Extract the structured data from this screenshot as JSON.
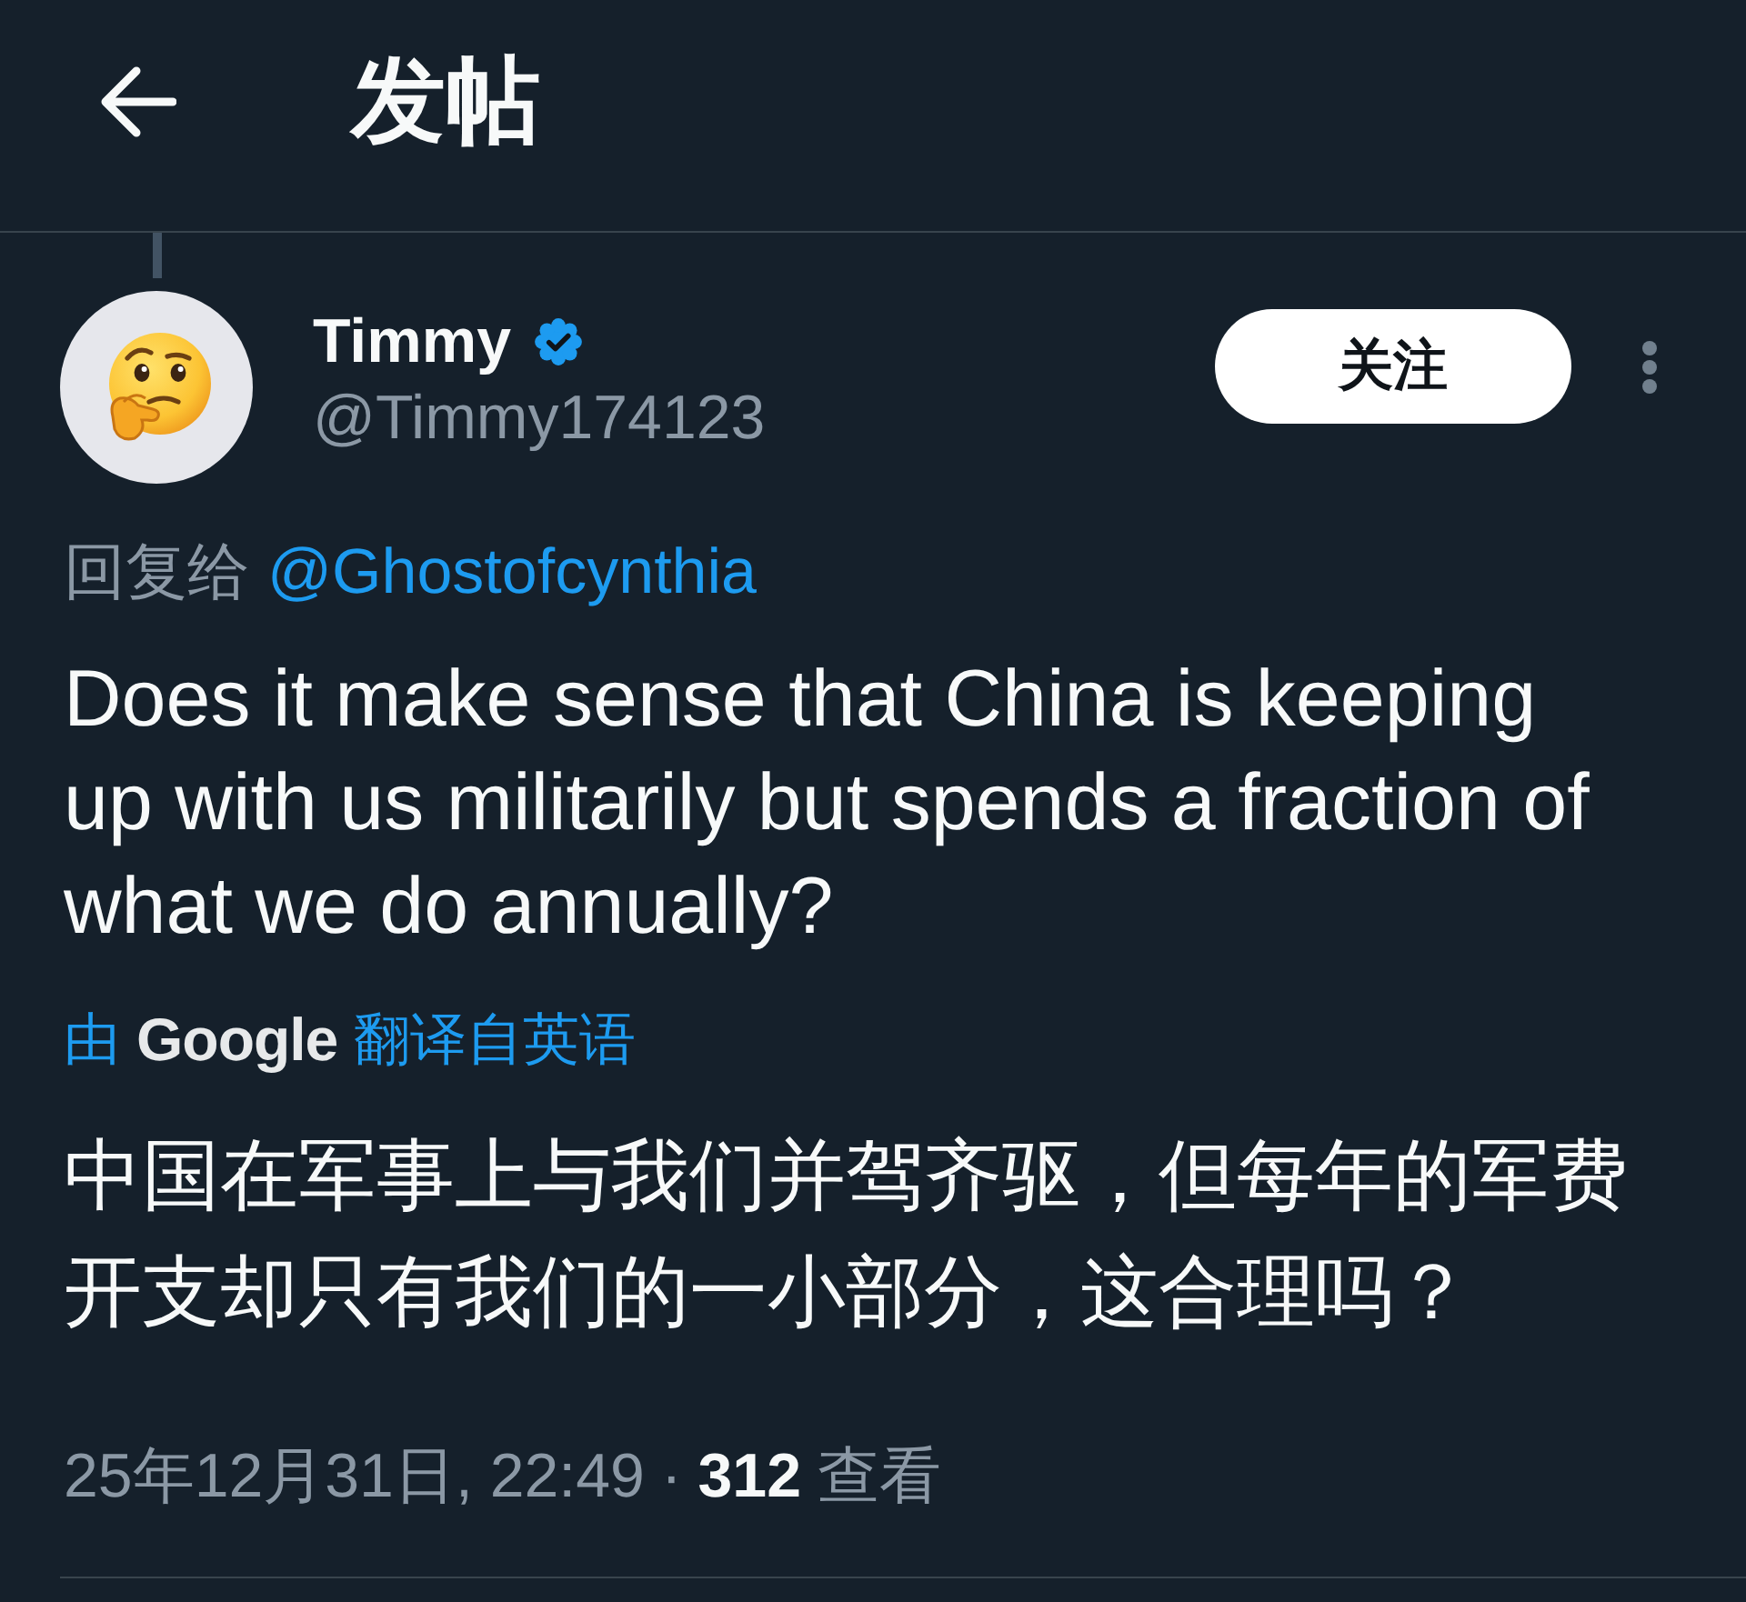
{
  "header": {
    "title": "发帖"
  },
  "post": {
    "author": {
      "name": "Timmy",
      "verified": true,
      "handle": "@Timmy174123"
    },
    "follow_button": {
      "label": "关注"
    },
    "reply_to": {
      "label": "回复给",
      "handle": "@Ghostofcynthia"
    },
    "text": "Does it make sense that China is keeping up with us militarily but spends a fraction of what we do annually?",
    "translation": {
      "prefix": "由",
      "provider": "Google",
      "label": "翻译自英语",
      "text": "中国在军事上与我们并驾齐驱，但每年的军费开支却只有我们的一小部分，这合理吗？"
    },
    "meta": {
      "timestamp": "25年12月31日, 22:49",
      "separator": "·",
      "views": "312",
      "views_label": "查看"
    }
  }
}
